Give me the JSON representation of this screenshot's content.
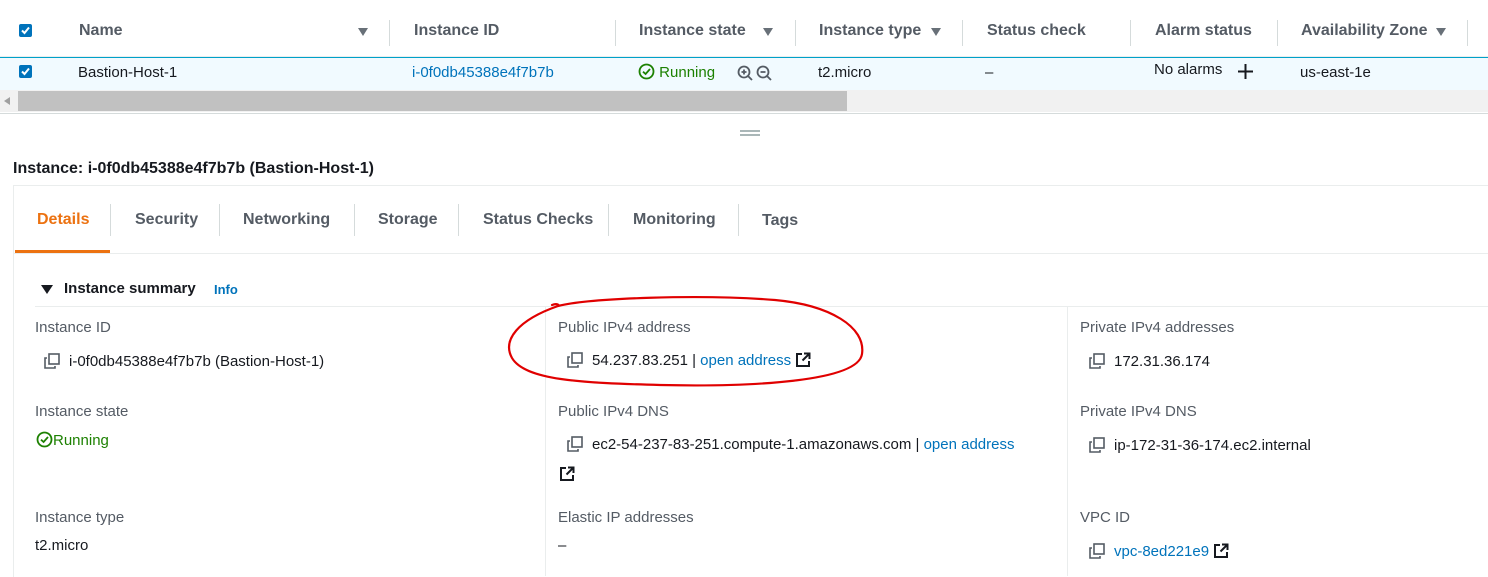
{
  "table": {
    "headers": {
      "name": "Name",
      "instance_id": "Instance ID",
      "instance_state": "Instance state",
      "instance_type": "Instance type",
      "status_check": "Status check",
      "alarm_status": "Alarm status",
      "availability_zone": "Availability Zone"
    },
    "row": {
      "name": "Bastion-Host-1",
      "instance_id": "i-0f0db45388e4f7b7b",
      "state": "Running",
      "type": "t2.micro",
      "status_check": "–",
      "alarm": "No alarms",
      "az": "us-east-1e"
    }
  },
  "instance_title": "Instance: i-0f0db45388e4f7b7b (Bastion-Host-1)",
  "tabs": [
    {
      "label": "Details",
      "active": true
    },
    {
      "label": "Security"
    },
    {
      "label": "Networking"
    },
    {
      "label": "Storage"
    },
    {
      "label": "Status Checks"
    },
    {
      "label": "Monitoring"
    },
    {
      "label": "Tags"
    }
  ],
  "summary": {
    "heading": "Instance summary",
    "info": "Info",
    "instance_id_label": "Instance ID",
    "instance_id_value": "i-0f0db45388e4f7b7b (Bastion-Host-1)",
    "public_ipv4_label": "Public IPv4 address",
    "public_ipv4_value": "54.237.83.251",
    "public_ipv4_sep": " | ",
    "open_address": "open address",
    "private_ipv4_label": "Private IPv4 addresses",
    "private_ipv4_value": "172.31.36.174",
    "instance_state_label": "Instance state",
    "instance_state_value": "Running",
    "public_dns_label": "Public IPv4 DNS",
    "public_dns_value": "ec2-54-237-83-251.compute-1.amazonaws.com",
    "private_dns_label": "Private IPv4 DNS",
    "private_dns_value": "ip-172-31-36-174.ec2.internal",
    "instance_type_label": "Instance type",
    "instance_type_value": "t2.micro",
    "elastic_ip_label": "Elastic IP addresses",
    "elastic_ip_value": "–",
    "vpc_label": "VPC ID",
    "vpc_value": "vpc-8ed221e9"
  },
  "colors": {
    "link": "#0073bb",
    "running": "#1d8102",
    "active_tab": "#ec7211",
    "annotation": "#e00000"
  }
}
